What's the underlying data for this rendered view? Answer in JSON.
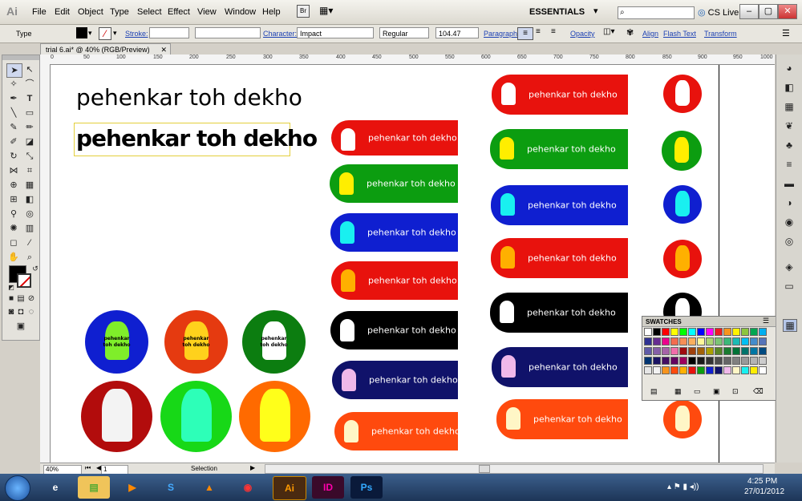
{
  "app": {
    "logo": "Ai",
    "essentials": "ESSENTIALS",
    "cslive": "CS Live"
  },
  "menu": [
    "File",
    "Edit",
    "Object",
    "Type",
    "Select",
    "Effect",
    "View",
    "Window",
    "Help"
  ],
  "window_buttons": [
    "–",
    "▢",
    "✕"
  ],
  "control": {
    "type_label": "Type",
    "stroke_label": "Stroke:",
    "character_label": "Character:",
    "font": "Impact",
    "style": "Regular",
    "size": "104.47",
    "paragraph_label": "Paragraph:",
    "opacity_label": "Opacity",
    "align_label": "Align",
    "flash_label": "Flash Text",
    "transform_label": "Transform"
  },
  "document_tab": "trial 6.ai* @ 40% (RGB/Preview)",
  "ruler_ticks": [
    "0",
    "50",
    "100",
    "150",
    "200",
    "250",
    "300",
    "350",
    "400",
    "450",
    "500",
    "550",
    "600",
    "650",
    "700",
    "750",
    "800",
    "850",
    "900",
    "950",
    "1000"
  ],
  "status": {
    "zoom": "40%",
    "page": "1",
    "mode": "Selection"
  },
  "artwork": {
    "heading_plain": "pehenkar toh dekho",
    "heading_bold": "pehenkar toh dekho",
    "pill_label": "pehenkar toh dekho",
    "circle_label_1": "pehenkar",
    "circle_label_2": "toh dekho",
    "colors": {
      "red": "#e8120d",
      "green": "#0c9d10",
      "blue": "#0f1fd0",
      "black": "#000000",
      "navy": "#10126a",
      "orange": "#ff4a0e",
      "condom_white": "#ffffff",
      "yellow": "#ffee00",
      "cyan": "#19f0f0",
      "amber": "#ffb000",
      "pink": "#f0b8ea",
      "cream": "#fff6c6"
    }
  },
  "swatches_panel": {
    "title": "SWATCHES"
  },
  "taskbar": {
    "time": "4:25 PM",
    "date": "27/01/2012"
  }
}
